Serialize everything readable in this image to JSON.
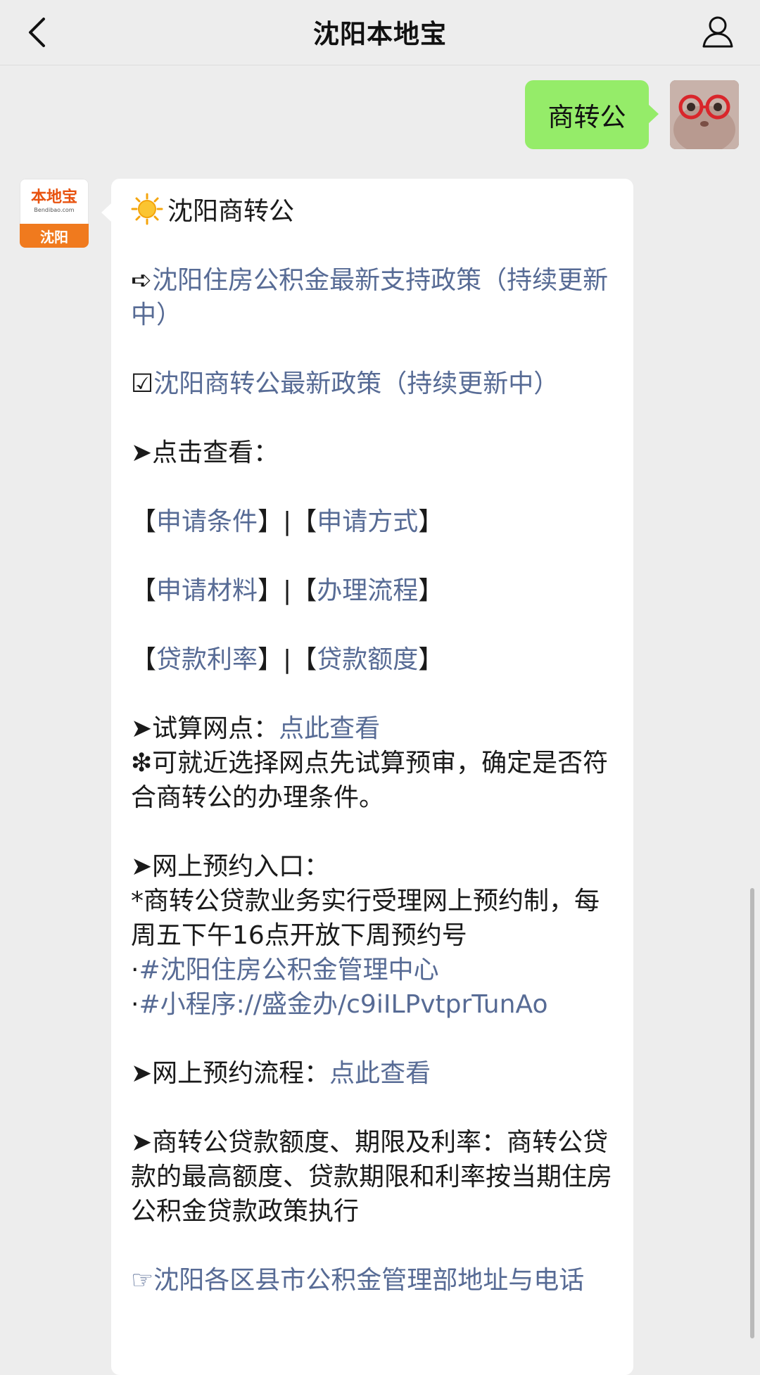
{
  "header": {
    "title": "沈阳本地宝",
    "back_icon": "chevron-left-icon",
    "profile_icon": "person-icon"
  },
  "user_message": {
    "text": "商转公",
    "bubble_color": "#95ec69"
  },
  "bot": {
    "avatar": {
      "logo_text": "本地宝",
      "logo_sub": "Bendibao.com",
      "city": "沈阳"
    },
    "heading": "沈阳商转公",
    "item1": {
      "icon": "➪",
      "link": "沈阳住房公积金最新支持政策（持续更新中）"
    },
    "item2": {
      "icon": "☑",
      "link": "沈阳商转公最新政策（持续更新中）"
    },
    "click_view": "➤点击查看：",
    "links_rows": [
      [
        "申请条件",
        "申请方式"
      ],
      [
        "申请材料",
        "办理流程"
      ],
      [
        "贷款利率",
        "贷款额度"
      ]
    ],
    "bracket_open": "【",
    "bracket_close": "】",
    "separator": "|",
    "trial": {
      "label": "➤试算网点：",
      "link": "点此查看",
      "note": "❇可就近选择网点先试算预审，确定是否符合商转公的办理条件。"
    },
    "booking": {
      "label": "➤网上预约入口：",
      "note": "*商转公贷款业务实行受理网上预约制，每周五下午16点开放下周预约号",
      "bullet": "·",
      "link1": "#沈阳住房公积金管理中心",
      "link2": "#小程序://盛金办/c9iILPvtprTunAo"
    },
    "process": {
      "label": "➤网上预约流程：",
      "link": "点此查看"
    },
    "limits": {
      "text": "➤商转公贷款额度、期限及利率：商转公贷款的最高额度、贷款期限和利率按当期住房公积金贷款政策执行"
    },
    "footer_link": {
      "icon": "☞",
      "text": "沈阳各区县市公积金管理部地址与电话"
    }
  },
  "colors": {
    "link": "#576b95",
    "background": "#ededed",
    "brand_orange": "#f07a1e"
  }
}
